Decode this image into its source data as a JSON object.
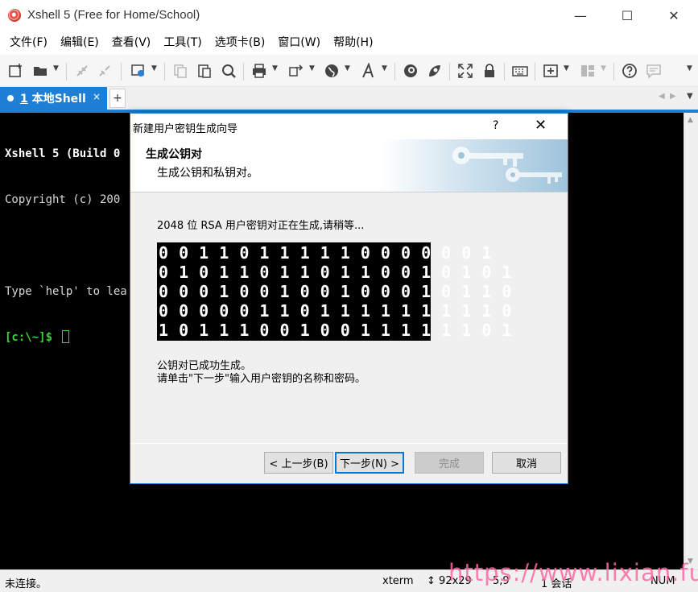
{
  "window": {
    "title": "Xshell 5 (Free for Home/School)",
    "minimize": "—",
    "maximize": "☐",
    "close": "✕"
  },
  "menu": [
    "文件(F)",
    "编辑(E)",
    "查看(V)",
    "工具(T)",
    "选项卡(B)",
    "窗口(W)",
    "帮助(H)"
  ],
  "toolbar_icons": [
    "new-session-icon",
    "open-folder-icon",
    "connect-icon",
    "disconnect-icon",
    "properties-icon",
    "copy-icon",
    "paste-icon",
    "find-icon",
    "print-icon",
    "transfer-icon",
    "globe-icon",
    "font-icon",
    "xftp-icon",
    "xagent-icon",
    "fullscreen-icon",
    "lock-icon",
    "keyboard-icon",
    "new-tab-icon",
    "layout-icon",
    "help-icon",
    "chat-icon"
  ],
  "tab": {
    "number": "1",
    "label": "本地Shell",
    "close": "×",
    "add": "+"
  },
  "terminal": {
    "line1": "Xshell 5 (Build 0",
    "line2": "Copyright (c) 200",
    "line3": "",
    "line4": "Type `help' to lea",
    "prompt": "[c:\\~]$ "
  },
  "dialog": {
    "title": "新建用户密钥生成向导",
    "help": "?",
    "close": "✕",
    "heading": "生成公钥对",
    "subheading": "生成公钥和私钥对。",
    "progress_text": "2048 位 RSA 用户密钥对正在生成,请稍等...",
    "bits": [
      "00110111110000001",
      "01011011011001010 1",
      "0001001001000101 10",
      "00000110111111111 0",
      "10111001001111110 1"
    ],
    "success_line1": "公钥对已成功生成。",
    "success_line2": "请单击\"下一步\"输入用户密钥的名称和密码。",
    "buttons": {
      "back": "< 上一步(B)",
      "next": "下一步(N) >",
      "finish": "完成",
      "cancel": "取消"
    }
  },
  "status": {
    "connection": "未连接。",
    "term_type": "xterm",
    "size": "92x29",
    "position": "5,9",
    "sessions": "1 会话",
    "num": "NUM"
  },
  "watermark": "https://www.lixian.fun",
  "colors": {
    "accent": "#1e7fd6",
    "terminal_bg": "#000000",
    "prompt": "#3ad33a",
    "watermark": "#ff6aa2"
  }
}
